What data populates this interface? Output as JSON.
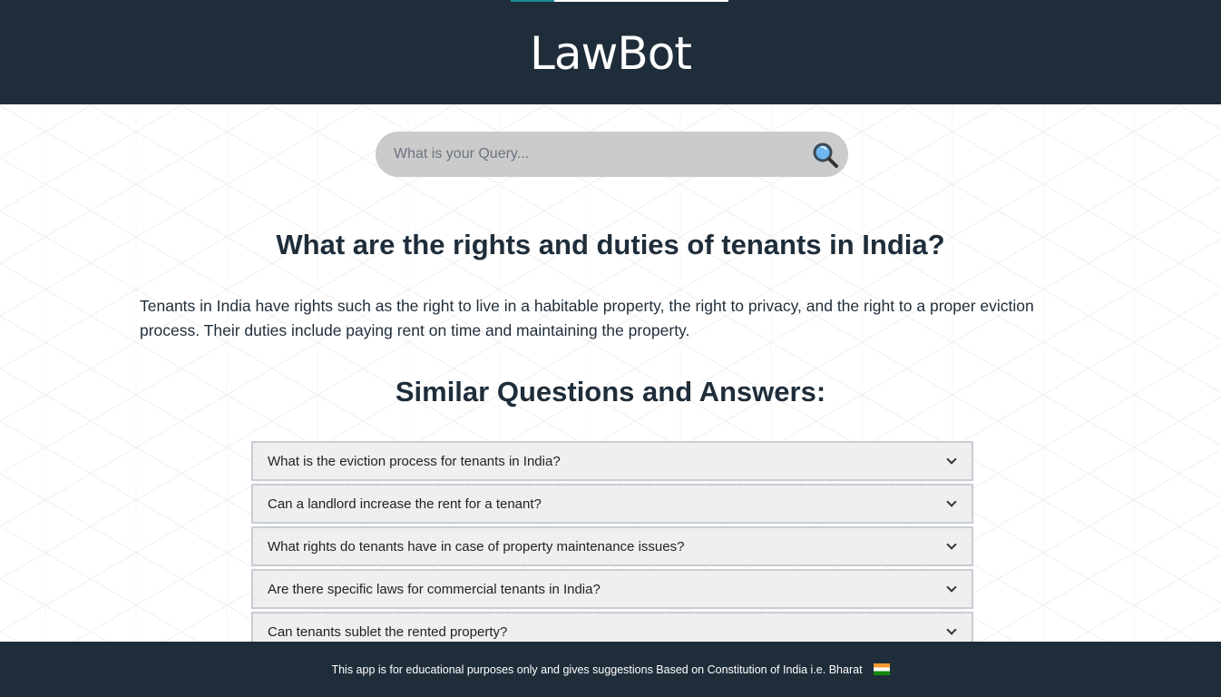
{
  "header": {
    "title": "LawBot",
    "progress_percent": 20
  },
  "search": {
    "placeholder": "What is your Query...",
    "value": "",
    "icon": "magnifier-icon"
  },
  "question": "What are the rights and duties of tenants in India?",
  "answer": "Tenants in India have rights such as the right to live in a habitable property, the right to privacy, and the right to a proper eviction process. Their duties include paying rent on time and maintaining the property.",
  "similar_heading": "Similar Questions and Answers:",
  "similar": [
    "What is the eviction process for tenants in India?",
    "Can a landlord increase the rent for a tenant?",
    "What rights do tenants have in case of property maintenance issues?",
    "Are there specific laws for commercial tenants in India?",
    "Can tenants sublet the rented property?"
  ],
  "footer": {
    "text": "This app is for educational purposes only and gives suggestions Based on Constitution of India i.e. Bharat",
    "flag": "india-flag-icon"
  }
}
